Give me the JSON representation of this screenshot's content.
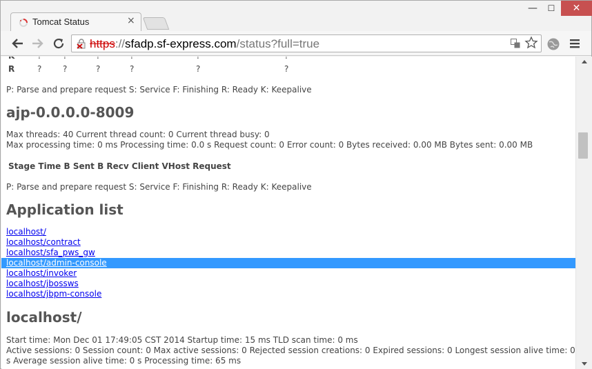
{
  "browser": {
    "tab_title": "Tomcat Status",
    "tab_close": "×",
    "url_scheme": "https",
    "url_sep": "://",
    "url_host": "sfadp.sf-express.com",
    "url_path": "/status?full=true",
    "window_min": "—",
    "window_max": "☐",
    "window_close": "✕"
  },
  "table_tail": {
    "row_partial": {
      "label": "K",
      "marks": [
        "?",
        "?",
        "?",
        "?",
        "?",
        "?"
      ]
    },
    "row_r": {
      "label": "R",
      "marks": [
        "?",
        "?",
        "?",
        "?",
        "?",
        "?"
      ]
    }
  },
  "legend_1": "P: Parse and prepare request S: Service F: Finishing R: Ready K: Keepalive",
  "connector": {
    "title": "ajp-0.0.0.0-8009",
    "threads_line": "Max threads: 40 Current thread count: 0 Current thread busy: 0",
    "processing_line": "Max processing time: 0 ms Processing time: 0.0 s Request count: 0 Error count: 0 Bytes received: 0.00 MB Bytes sent: 0.00 MB",
    "table_header": "Stage Time B Sent B Recv Client VHost Request",
    "legend": "P: Parse and prepare request S: Service F: Finishing R: Ready K: Keepalive"
  },
  "application_list": {
    "title": "Application list",
    "items": [
      {
        "label": "localhost/"
      },
      {
        "label": "localhost/contract"
      },
      {
        "label": "localhost/sfa_pws_gw"
      },
      {
        "label": "localhost/admin-console"
      },
      {
        "label": "localhost/invoker"
      },
      {
        "label": "localhost/jbossws"
      },
      {
        "label": "localhost/jbpm-console"
      }
    ]
  },
  "app_detail": {
    "title": "localhost/",
    "start_line": "Start time: Mon Dec 01 17:49:05 CST 2014 Startup time: 15 ms TLD scan time: 0 ms",
    "sessions_line": "Active sessions: 0 Session count: 0 Max active sessions: 0 Rejected session creations: 0 Expired sessions: 0 Longest session alive time: 0",
    "avg_line": "s Average session alive time: 0 s Processing time: 65 ms"
  },
  "colors": {
    "selection": "#3399ff",
    "link": "#0000ee",
    "insecure": "#cc0000"
  }
}
